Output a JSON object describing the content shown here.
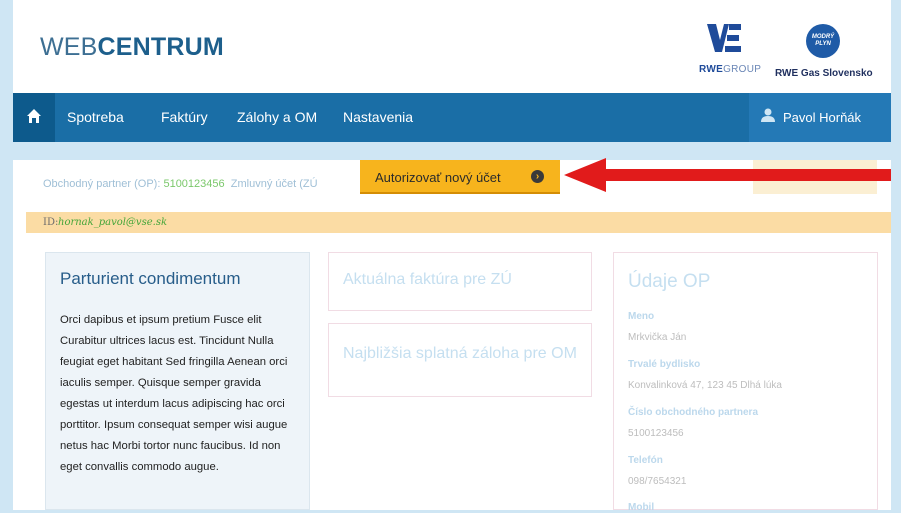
{
  "header": {
    "logo_light": "WEB",
    "logo_bold": "CENTRUM",
    "rwe_group_bold": "RWE",
    "rwe_group_light": "GROUP",
    "gas_badge": "MODRÝ PLYN",
    "gas_name": "RWE Gas Slovensko"
  },
  "nav": {
    "items": [
      "Spotreba",
      "Faktúry",
      "Zálohy a OM",
      "Nastavenia"
    ],
    "user_name": "Pavol Horňák"
  },
  "partner": {
    "op_label": "Obchodný partner (OP):",
    "op_value": "5100123456",
    "zu_label": "Zmluvný účet (ZÚ"
  },
  "authorize_button": "Autorizovať nový účet",
  "id_strip": {
    "label": "ID:",
    "value": "hornak_pavol@vse.sk"
  },
  "left_card": {
    "title": "Parturient condimentum",
    "body": "Orci dapibus et ipsum pretium Fusce elit Curabitur ultrices lacus est. Tincidunt Nulla feugiat eget habitant Sed fringilla Aenean orci iaculis semper. Quisque semper gravida egestas ut interdum lacus adipiscing hac orci porttitor. Ipsum consequat semper wisi augue netus hac Morbi tortor nunc faucibus. Id non eget convallis commodo augue."
  },
  "middle_cards": {
    "invoice_title": "Aktuálna faktúra pre ZÚ",
    "deposit_title": "Najbližšia splatná záloha pre OM"
  },
  "op_details": {
    "title": "Údaje OP",
    "fields": [
      {
        "label": "Meno",
        "value": "Mrkvička Ján"
      },
      {
        "label": "Trvalé bydlisko",
        "value": "Konvalinková 47, 123 45 Dlhá lúka"
      },
      {
        "label": "Číslo obchodného partnera",
        "value": "5100123456"
      },
      {
        "label": "Telefón",
        "value": "098/7654321"
      },
      {
        "label": "Mobil",
        "value": ""
      }
    ]
  },
  "colors": {
    "nav_blue": "#1a6ea6",
    "button_orange": "#f7b41d",
    "arrow_red": "#e11b1b",
    "id_strip": "#fbdca4"
  }
}
